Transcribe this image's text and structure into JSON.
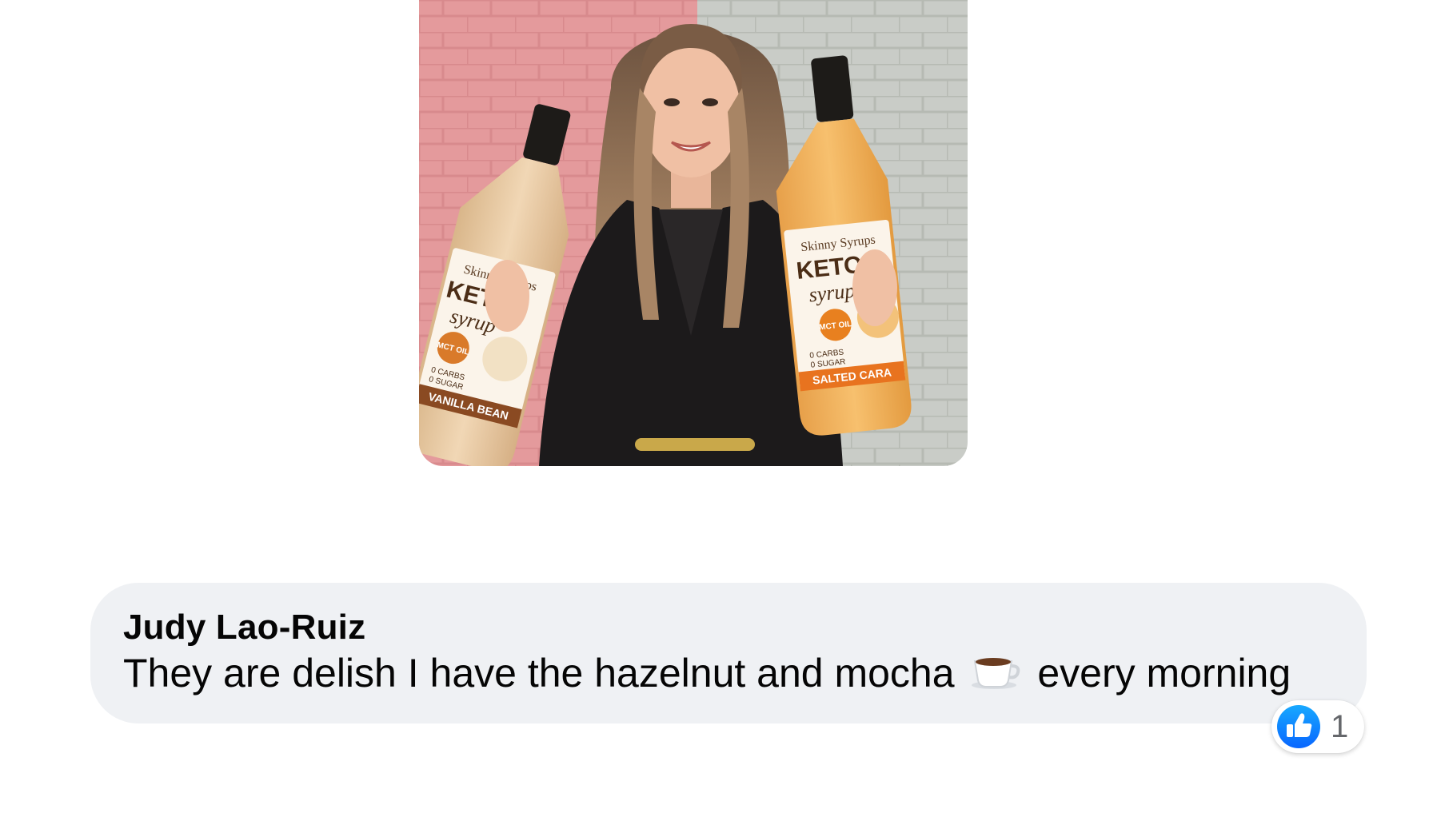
{
  "post_photo": {
    "subject": "woman holding two keto syrup bottles",
    "left_bottle": {
      "brand": "Skinny Syrups",
      "line1": "KETO",
      "line2": "syrup",
      "badge": "MCT OIL",
      "carbs": "0 CARBS",
      "sugar": "0 SUGAR",
      "flavor": "VANILLA BEAN"
    },
    "right_bottle": {
      "brand": "Skinny Syrups",
      "line1": "KETO",
      "line2": "syrup",
      "badge": "MCT OIL",
      "carbs": "0 CARBS",
      "sugar": "0 SUGAR",
      "flavor": "SALTED CARA"
    },
    "colors": {
      "wall_left": "#e49a9c",
      "wall_right": "#c9ccc7",
      "syrup_vanilla": "#e9c9a0",
      "syrup_caramel": "#f0ae4c"
    }
  },
  "comment": {
    "author": "Judy Lao-Ruiz",
    "text_before_emoji": "They are delish I have the hazelnut and mocha",
    "emoji": "hot-beverage",
    "text_after_emoji": "every morning",
    "bubble_color": "#eff1f4"
  },
  "reactions": {
    "icon": "like-icon",
    "icon_color": "#1877f2",
    "count": "1"
  }
}
